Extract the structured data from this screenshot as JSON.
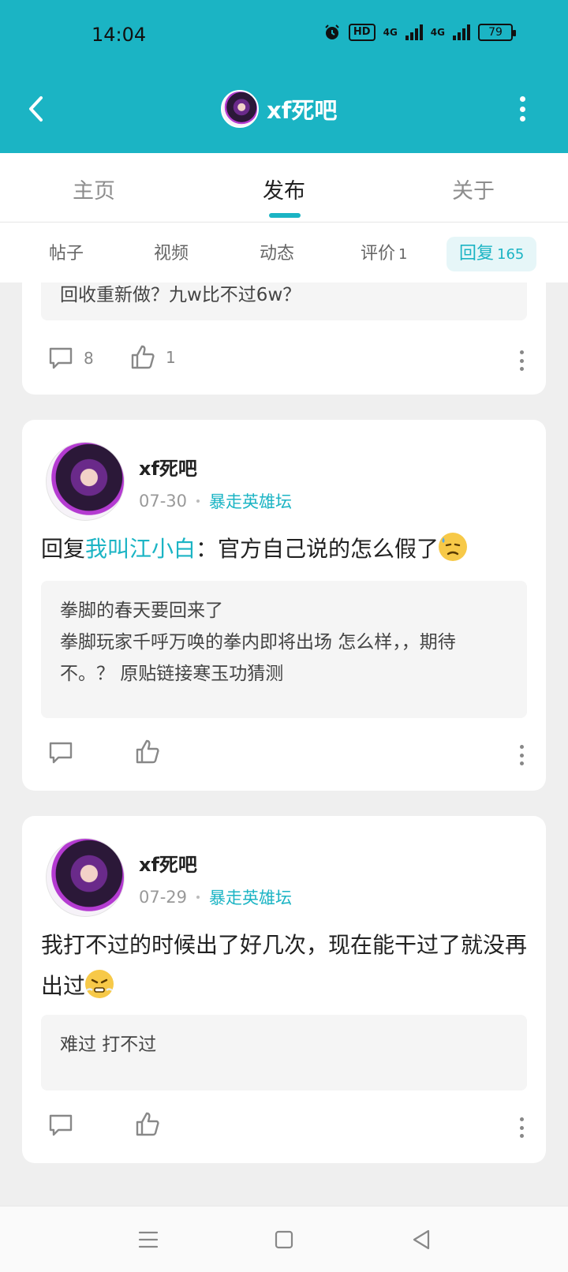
{
  "status_bar": {
    "time": "14:04",
    "hd_label": "HD",
    "net_label_1": "4G",
    "net_label_2": "4G",
    "battery": "79"
  },
  "header": {
    "title": "xf死吧"
  },
  "tabs": [
    {
      "label": "主页"
    },
    {
      "label": "发布"
    },
    {
      "label": "关于"
    }
  ],
  "subtabs": [
    {
      "label": "帖子",
      "count": ""
    },
    {
      "label": "视频",
      "count": ""
    },
    {
      "label": "动态",
      "count": ""
    },
    {
      "label": "评价",
      "count": "1"
    },
    {
      "label": "回复",
      "count": "165"
    }
  ],
  "posts": [
    {
      "quote_text": "回收重新做？九w比不过6w？",
      "comment_count": "8",
      "like_count": "1"
    },
    {
      "author": "xf死吧",
      "date": "07-30",
      "forum": "暴走英雄坛",
      "reply_prefix": "回复",
      "mention": "我叫江小白",
      "body": "：官方自己说的怎么假了",
      "quote_title": "拳脚的春天要回来了",
      "quote_body": "拳脚玩家千呼万唤的拳内即将出场 怎么样，，期待不。？ 原贴链接寒玉功猜测"
    },
    {
      "author": "xf死吧",
      "date": "07-29",
      "forum": "暴走英雄坛",
      "body": "我打不过的时候出了好几次，现在能干过了就没再出过",
      "quote_text": "难过 打不过"
    }
  ],
  "colors": {
    "accent": "#1bb4c4",
    "background": "#efefef"
  },
  "icons": {
    "back": "chevron-left-icon",
    "more": "more-vertical-icon",
    "comment": "comment-icon",
    "like": "thumbs-up-icon"
  }
}
